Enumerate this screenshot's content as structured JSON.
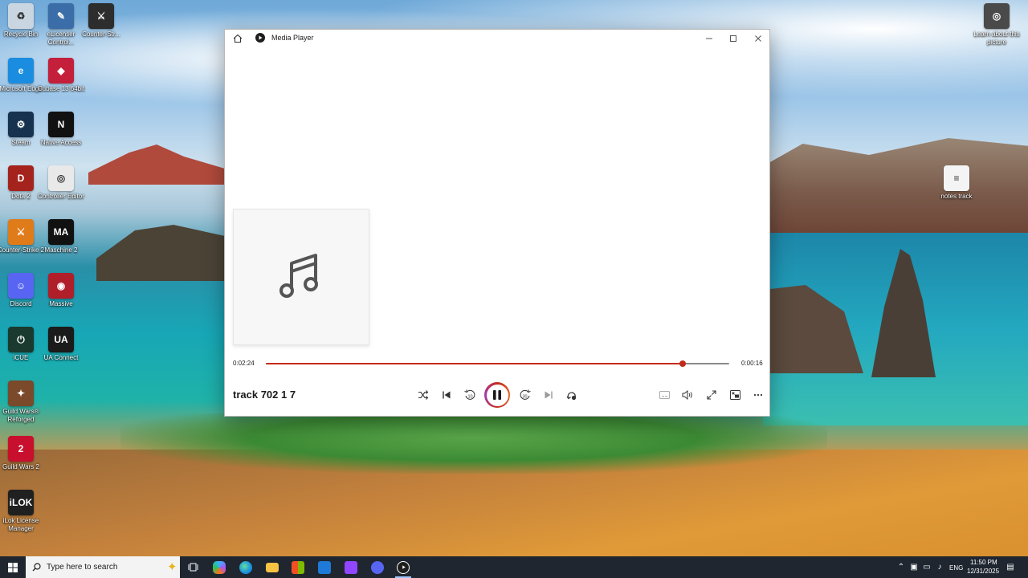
{
  "desktop": {
    "icons_left": [
      {
        "label": "Recycle Bin",
        "glyph": "♻",
        "color": "#c9d6e2",
        "icon": "recycle-bin-icon"
      },
      {
        "label": "eLicenser Control...",
        "glyph": "✎",
        "color": "#3b6ea8",
        "icon": "elicenser-icon"
      },
      {
        "label": "Counter-Str...",
        "glyph": "⚔",
        "color": "#2d2d2d",
        "icon": "counter-strike-icon"
      },
      {
        "label": "Microsoft Edge",
        "glyph": "e",
        "color": "#1a8de0",
        "icon": "edge-icon"
      },
      {
        "label": "Cubase 13 64bit",
        "glyph": "◆",
        "color": "#c41f3b",
        "icon": "cubase-icon"
      },
      {
        "label": "Steam",
        "glyph": "⚙",
        "color": "#17324f",
        "icon": "steam-icon"
      },
      {
        "label": "Native Access",
        "glyph": "N",
        "color": "#111111",
        "icon": "native-access-icon"
      },
      {
        "label": "Dota 2",
        "glyph": "D",
        "color": "#a5231d",
        "icon": "dota2-icon"
      },
      {
        "label": "Controller Editor",
        "glyph": "◎",
        "color": "#e9e9e9",
        "icon": "controller-editor-icon"
      },
      {
        "label": "Counter-Strike 2",
        "glyph": "⚔",
        "color": "#e07b1a",
        "icon": "counter-strike2-icon"
      },
      {
        "label": "Maschine 2",
        "glyph": "MA",
        "color": "#111111",
        "icon": "maschine-icon"
      },
      {
        "label": "Discord",
        "glyph": "☺",
        "color": "#5865f2",
        "icon": "discord-icon"
      },
      {
        "label": "Massive",
        "glyph": "◉",
        "color": "#b01e2a",
        "icon": "massive-icon"
      },
      {
        "label": "iCUE",
        "glyph": "⏻",
        "color": "#1b3a2f",
        "icon": "icue-icon"
      },
      {
        "label": "UA Connect",
        "glyph": "UA",
        "color": "#1b1b1b",
        "icon": "ua-connect-icon"
      },
      {
        "label": "Guild Wars® Reforged",
        "glyph": "✦",
        "color": "#7a4a2a",
        "icon": "guild-wars-reforged-icon"
      },
      {
        "label": "Guild Wars 2",
        "glyph": "2",
        "color": "#c8102e",
        "icon": "guild-wars2-icon"
      },
      {
        "label": "iLok License Manager",
        "glyph": "iLOK",
        "color": "#202020",
        "icon": "ilok-icon"
      }
    ],
    "icons_right": [
      {
        "label": "Learn about this picture",
        "glyph": "◎",
        "color": "#4a4a4a",
        "icon": "learn-picture-icon"
      },
      {
        "label": "notes track",
        "glyph": "≡",
        "color": "#f4f4f4",
        "icon": "text-file-icon"
      }
    ]
  },
  "player": {
    "app_title": "Media Player",
    "current_time": "0:02:24",
    "remaining_time": "0:00:16",
    "progress": 0.9,
    "track_title": "track 702 1 7",
    "accent_color": "#c42b1c",
    "controls": {
      "skip_back_label": "10",
      "skip_forward_label": "30"
    }
  },
  "taskbar": {
    "search_placeholder": "Type here to search",
    "language": "ENG",
    "clock_time": "11:50 PM",
    "clock_date": "12/31/2025"
  }
}
